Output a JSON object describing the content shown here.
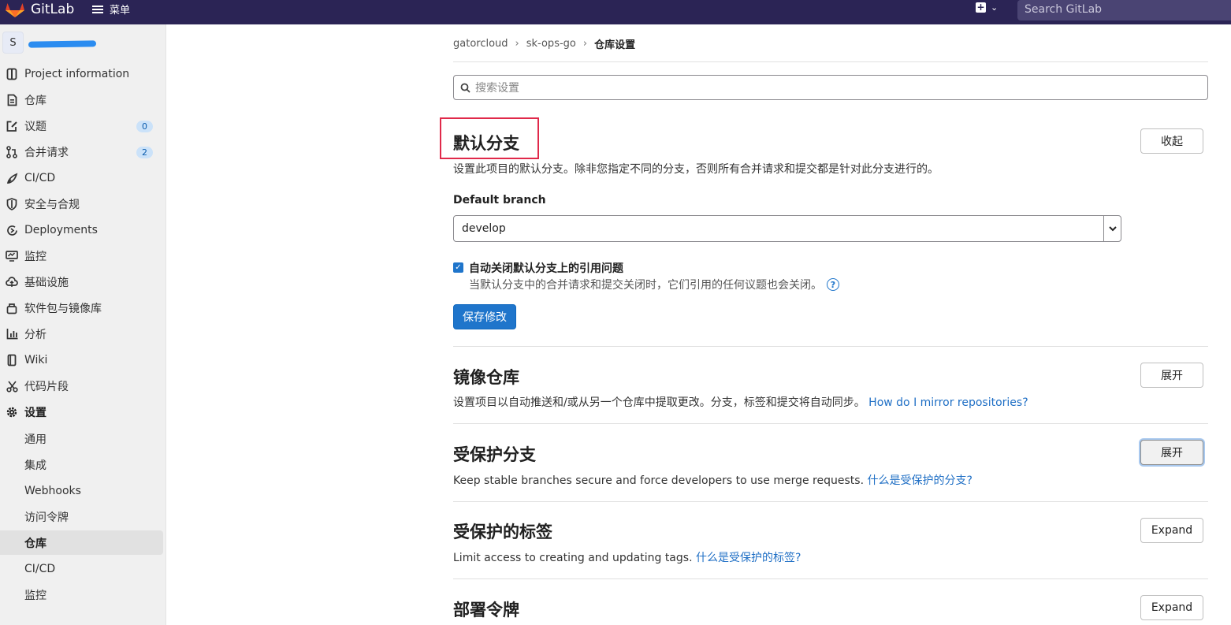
{
  "topbar": {
    "logo_text": "GitLab",
    "menu_label": "菜单",
    "search_placeholder": "Search GitLab",
    "brand_color": "#2b2455"
  },
  "sidebar": {
    "project_avatar": "S",
    "items": [
      {
        "label": "Project information",
        "icon": "project-icon"
      },
      {
        "label": "仓库",
        "icon": "repository-icon"
      },
      {
        "label": "议题",
        "icon": "issues-icon",
        "badge": "0"
      },
      {
        "label": "合并请求",
        "icon": "merge-request-icon",
        "badge": "2"
      },
      {
        "label": "CI/CD",
        "icon": "rocket-icon"
      },
      {
        "label": "安全与合规",
        "icon": "shield-icon"
      },
      {
        "label": "Deployments",
        "icon": "deployments-icon"
      },
      {
        "label": "监控",
        "icon": "monitor-icon"
      },
      {
        "label": "基础设施",
        "icon": "cloud-icon"
      },
      {
        "label": "软件包与镜像库",
        "icon": "package-icon"
      },
      {
        "label": "分析",
        "icon": "chart-icon"
      },
      {
        "label": "Wiki",
        "icon": "book-icon"
      },
      {
        "label": "代码片段",
        "icon": "snippet-icon"
      },
      {
        "label": "设置",
        "icon": "gear-icon"
      }
    ],
    "sub_items": [
      {
        "label": "通用"
      },
      {
        "label": "集成"
      },
      {
        "label": "Webhooks"
      },
      {
        "label": "访问令牌"
      },
      {
        "label": "仓库",
        "active": true
      },
      {
        "label": "CI/CD"
      },
      {
        "label": "监控"
      }
    ]
  },
  "breadcrumb": [
    "gatorcloud",
    "sk-ops-go",
    "仓库设置"
  ],
  "search": {
    "placeholder": "搜索设置"
  },
  "sections": {
    "default_branch": {
      "title": "默认分支",
      "description": "设置此项目的默认分支。除非您指定不同的分支，否则所有合并请求和提交都是针对此分支进行的。",
      "button": "收起",
      "field_label": "Default branch",
      "selected_branch": "develop",
      "checkbox_label": "自动关闭默认分支上的引用问题",
      "checkbox_help": "当默认分支中的合并请求和提交关闭时，它们引用的任何议题也会关闭。",
      "checkbox_checked": true,
      "save_button": "保存修改"
    },
    "mirror": {
      "title": "镜像仓库",
      "description": "设置项目以自动推送和/或从另一个仓库中提取更改。分支，标签和提交将自动同步。",
      "link": "How do I mirror repositories?",
      "button": "展开"
    },
    "protected_branches": {
      "title": "受保护分支",
      "description": "Keep stable branches secure and force developers to use merge requests.",
      "link": "什么是受保护的分支?",
      "button": "展开"
    },
    "protected_tags": {
      "title": "受保护的标签",
      "description": "Limit access to creating and updating tags.",
      "link": "什么是受保护的标签?",
      "button": "Expand"
    },
    "deploy_tokens": {
      "title": "部署令牌",
      "button": "Expand"
    }
  },
  "colors": {
    "link": "#1f6fc5",
    "primary_button": "#1f75cb",
    "highlight_box": "#e0294a"
  }
}
